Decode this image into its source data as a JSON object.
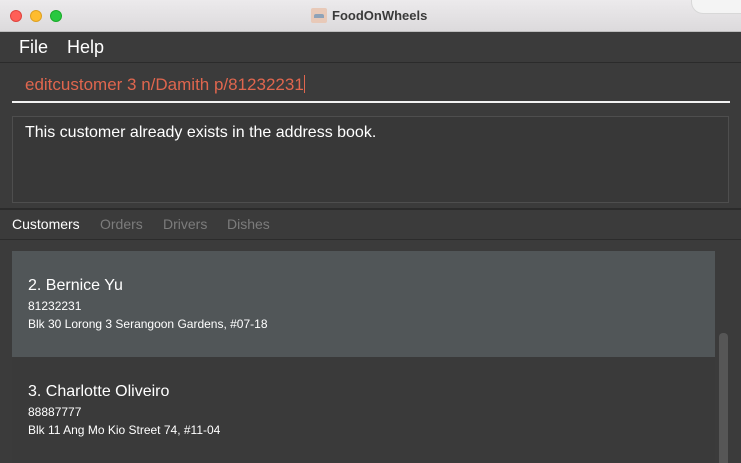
{
  "window": {
    "title": "FoodOnWheels"
  },
  "menu": {
    "file": "File",
    "help": "Help"
  },
  "command": {
    "value": "editcustomer 3 n/Damith p/81232231"
  },
  "result": {
    "message": "This customer already exists in the address book."
  },
  "tabs": [
    {
      "label": "Customers"
    },
    {
      "label": "Orders"
    },
    {
      "label": "Drivers"
    },
    {
      "label": "Dishes"
    }
  ],
  "customers": [
    {
      "index_name": "2.  Bernice Yu",
      "phone": "81232231",
      "address": "Blk 30 Lorong 3 Serangoon Gardens, #07-18"
    },
    {
      "index_name": "3.  Charlotte Oliveiro",
      "phone": "88887777",
      "address": "Blk 11 Ang Mo Kio Street 74, #11-04"
    }
  ],
  "colors": {
    "background": "#3b3b3b",
    "command_text": "#e0664e",
    "selected_card": "#515658",
    "active_tab": "#ffffff",
    "inactive_tab": "#7c7c7c"
  }
}
